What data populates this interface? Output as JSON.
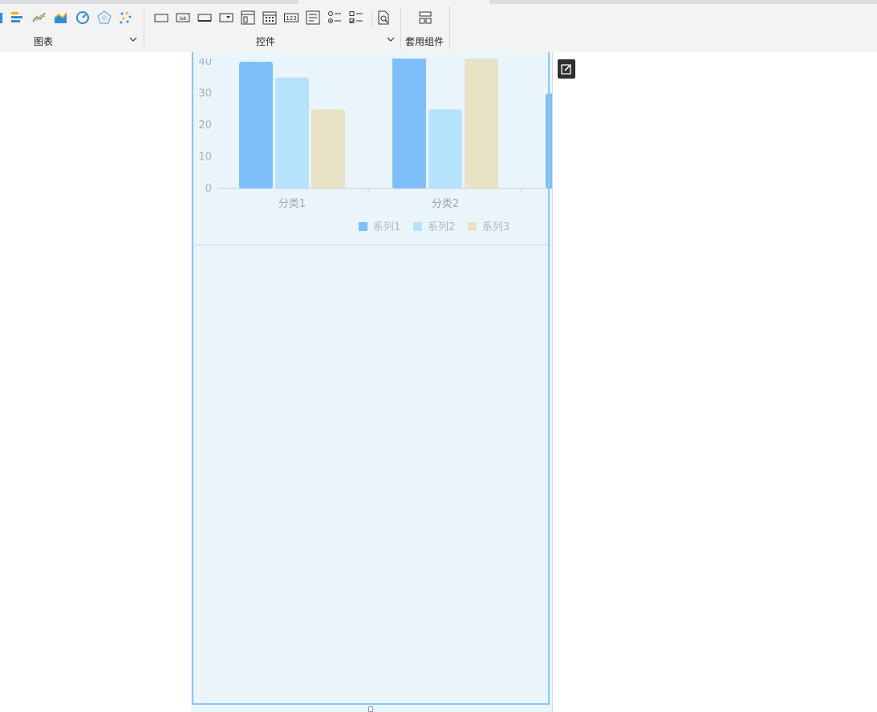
{
  "toolbar": {
    "groups": [
      {
        "label": "图表"
      },
      {
        "label": "控件"
      },
      {
        "label": "套用组件"
      }
    ],
    "widget_icons": {
      "label_icon_text": "lab",
      "number_icon_text": "123"
    }
  },
  "chart_data": {
    "type": "bar",
    "categories": [
      "分类1",
      "分类2"
    ],
    "series": [
      {
        "name": "系列1",
        "values": [
          40,
          43
        ],
        "color": "#7fbff9"
      },
      {
        "name": "系列2",
        "values": [
          35,
          25
        ],
        "color": "#b5e3fb"
      },
      {
        "name": "系列3",
        "values": [
          25,
          45
        ],
        "color": "#e9e3c6"
      }
    ],
    "yticks": [
      "0",
      "10",
      "20",
      "30",
      "40"
    ],
    "ylim": [
      0,
      40
    ],
    "legend_position": "bottom-right",
    "grid": false
  }
}
